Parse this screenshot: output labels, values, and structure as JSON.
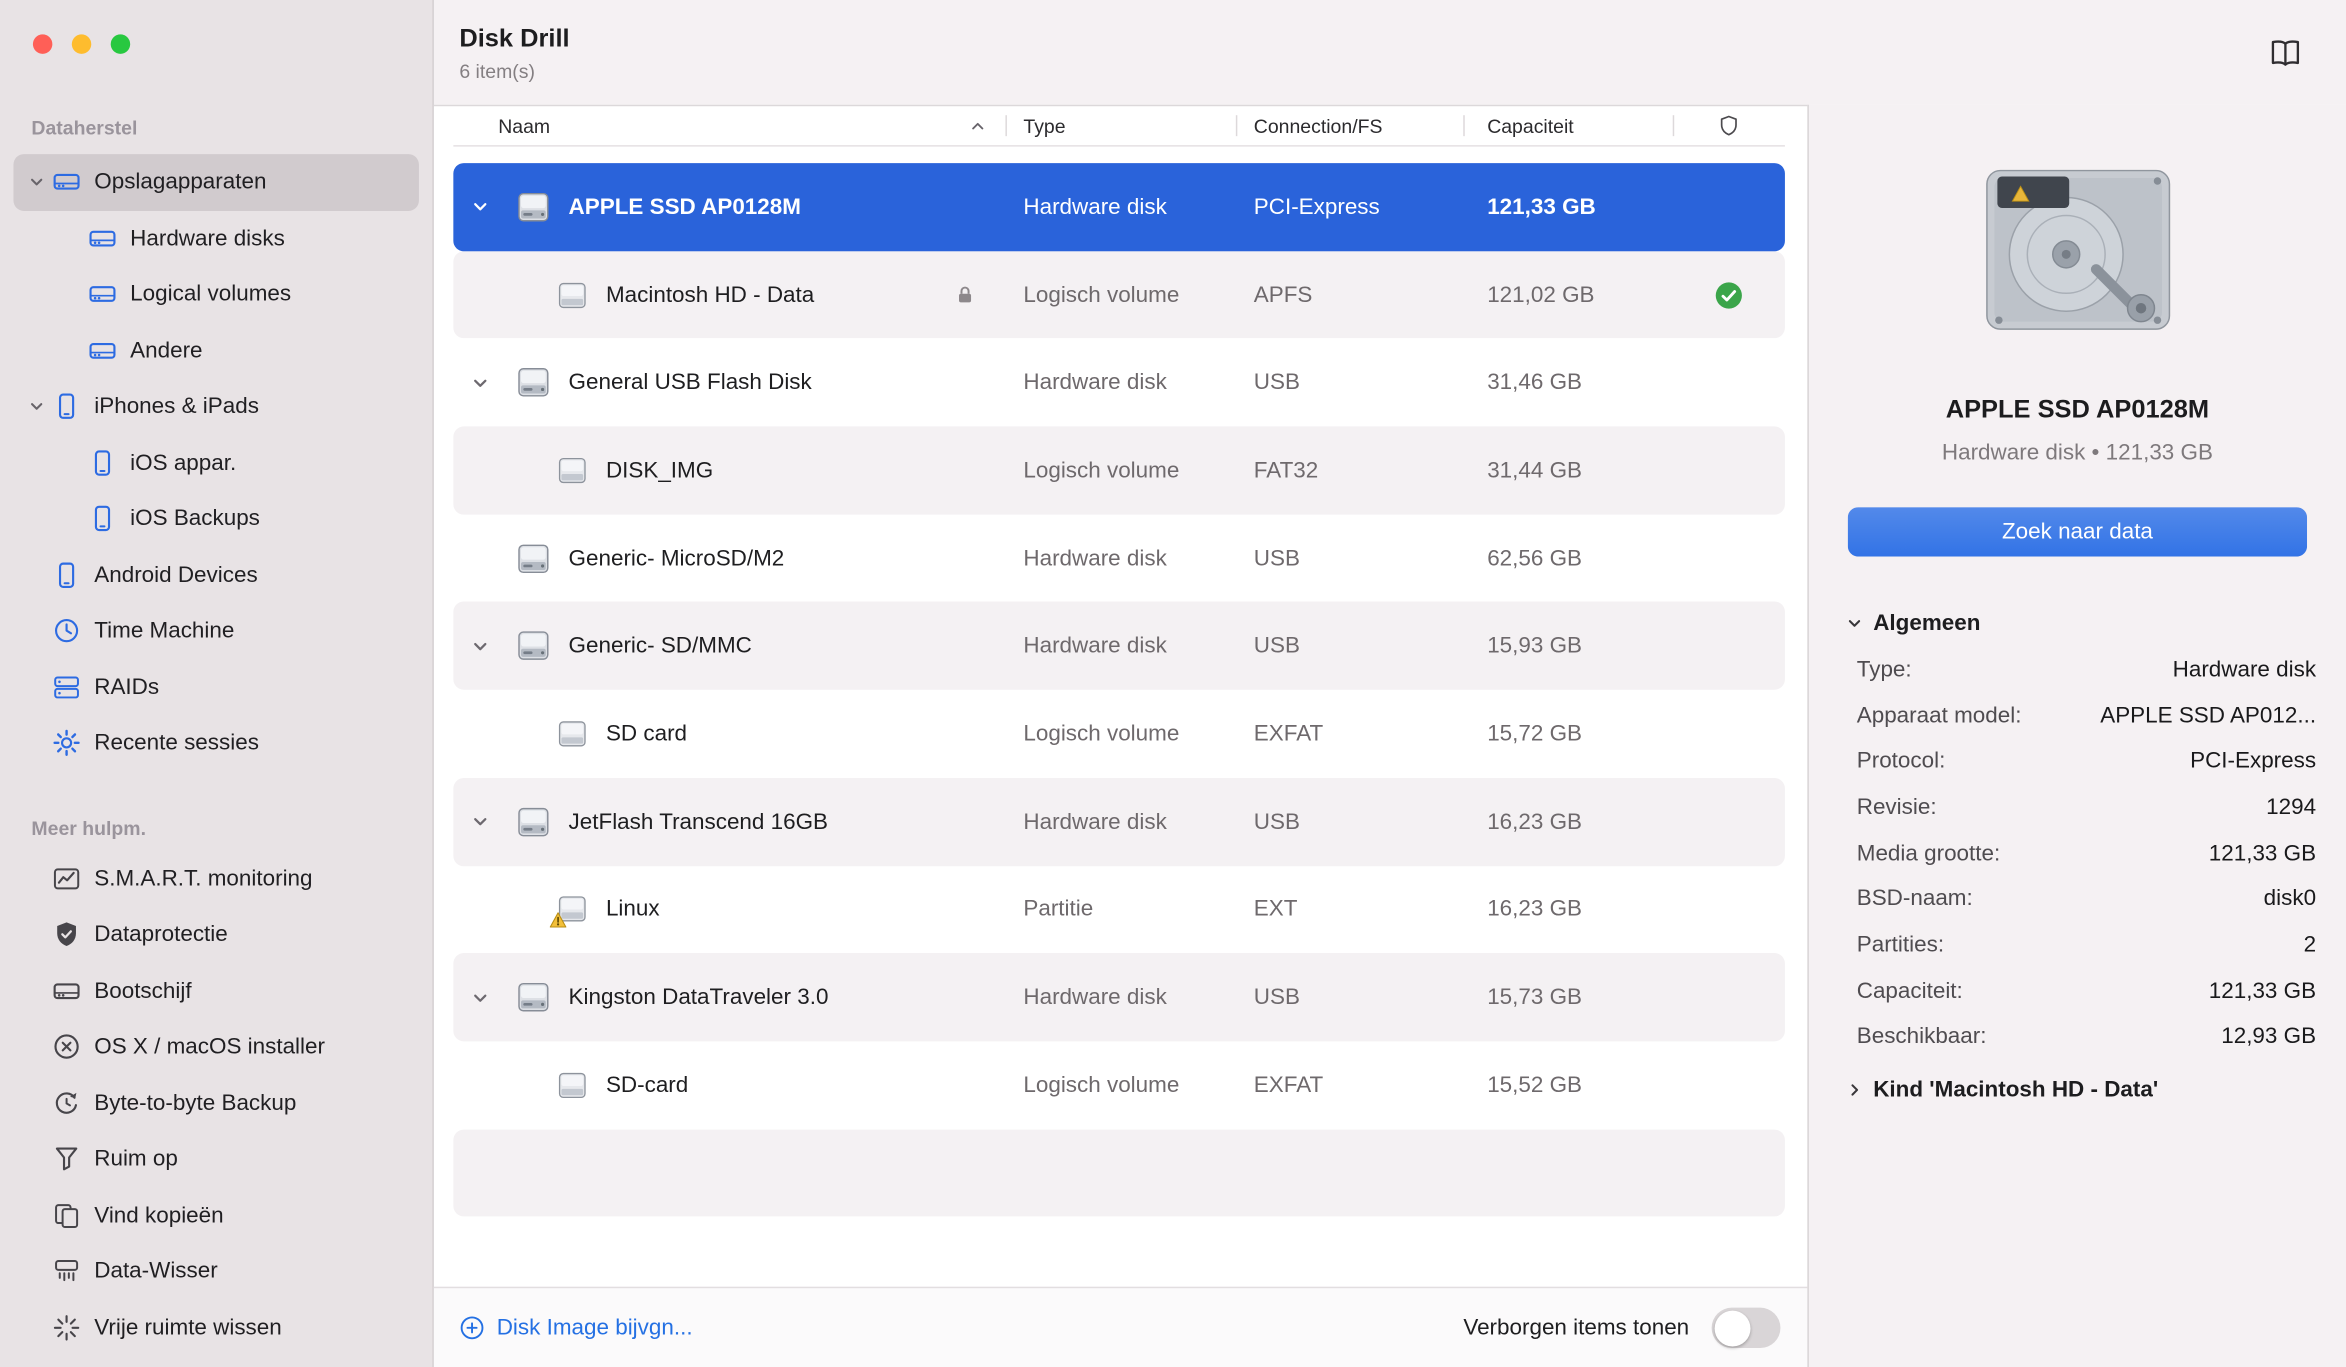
{
  "colors": {
    "accent_blue": "#2d6be2",
    "selection_blue": "#2a63da",
    "link_blue": "#2470e3",
    "status_green": "#3ba54a",
    "button_blue": "#3273e6"
  },
  "window": {
    "title": "Disk Drill",
    "item_count": "6 item(s)"
  },
  "sidebar": {
    "sections": [
      {
        "label": "Dataherstel",
        "items": [
          {
            "label": "Opslagapparaten",
            "icon": "drive-icon",
            "expandable": true,
            "expanded": true,
            "selected": true,
            "indent": 0
          },
          {
            "label": "Hardware disks",
            "icon": "drive-icon",
            "indent": 1
          },
          {
            "label": "Logical volumes",
            "icon": "drive-icon",
            "indent": 1
          },
          {
            "label": "Andere",
            "icon": "drive-icon",
            "indent": 1
          },
          {
            "label": "iPhones & iPads",
            "icon": "phone-icon",
            "expandable": true,
            "expanded": true,
            "indent": 0
          },
          {
            "label": "iOS appar.",
            "icon": "phone-icon",
            "indent": 1
          },
          {
            "label": "iOS Backups",
            "icon": "phone-icon",
            "indent": 1
          },
          {
            "label": "Android Devices",
            "icon": "phone-icon",
            "indent": 0
          },
          {
            "label": "Time Machine",
            "icon": "time-machine-icon",
            "indent": 0
          },
          {
            "label": "RAIDs",
            "icon": "raid-icon",
            "indent": 0
          },
          {
            "label": "Recente sessies",
            "icon": "gear-icon",
            "indent": 0
          }
        ]
      },
      {
        "label": "Meer hulpm.",
        "items": [
          {
            "label": "S.M.A.R.T. monitoring",
            "icon": "chart-icon",
            "indent": 0
          },
          {
            "label": "Dataprotectie",
            "icon": "shield-icon",
            "indent": 0
          },
          {
            "label": "Bootschijf",
            "icon": "drive-icon",
            "indent": 0
          },
          {
            "label": "OS X / macOS installer",
            "icon": "installer-icon",
            "indent": 0
          },
          {
            "label": "Byte-to-byte Backup",
            "icon": "backup-icon",
            "indent": 0
          },
          {
            "label": "Ruim op",
            "icon": "cleanup-icon",
            "indent": 0
          },
          {
            "label": "Vind kopieën",
            "icon": "copies-icon",
            "indent": 0
          },
          {
            "label": "Data-Wisser",
            "icon": "shredder-icon",
            "indent": 0
          },
          {
            "label": "Vrije ruimte wissen",
            "icon": "sparkle-icon",
            "indent": 0
          }
        ]
      }
    ]
  },
  "table": {
    "header": {
      "name": "Naam",
      "type": "Type",
      "fs": "Connection/FS",
      "capacity": "Capaciteit"
    },
    "sort": {
      "column": "Naam",
      "direction": "ascending"
    },
    "rows": [
      {
        "name": "APPLE SSD AP0128M",
        "type": "Hardware disk",
        "fs": "PCI-Express",
        "capacity": "121,33 GB",
        "level": 0,
        "expandable": true,
        "selected": true,
        "icon": "hard-drive-icon"
      },
      {
        "name": "Macintosh HD - Data",
        "type": "Logisch volume",
        "fs": "APFS",
        "capacity": "121,02 GB",
        "level": 1,
        "locked": true,
        "status": "ok",
        "icon": "volume-icon"
      },
      {
        "name": "General USB Flash Disk",
        "type": "Hardware disk",
        "fs": "USB",
        "capacity": "31,46 GB",
        "level": 0,
        "expandable": true,
        "icon": "hard-drive-icon"
      },
      {
        "name": "DISK_IMG",
        "type": "Logisch volume",
        "fs": "FAT32",
        "capacity": "31,44 GB",
        "level": 1,
        "icon": "volume-icon"
      },
      {
        "name": "Generic- MicroSD/M2",
        "type": "Hardware disk",
        "fs": "USB",
        "capacity": "62,56 GB",
        "level": 0,
        "icon": "hard-drive-icon"
      },
      {
        "name": "Generic- SD/MMC",
        "type": "Hardware disk",
        "fs": "USB",
        "capacity": "15,93 GB",
        "level": 0,
        "expandable": true,
        "icon": "hard-drive-icon"
      },
      {
        "name": "SD card",
        "type": "Logisch volume",
        "fs": "EXFAT",
        "capacity": "15,72 GB",
        "level": 1,
        "icon": "volume-icon"
      },
      {
        "name": "JetFlash Transcend 16GB",
        "type": "Hardware disk",
        "fs": "USB",
        "capacity": "16,23 GB",
        "level": 0,
        "expandable": true,
        "icon": "hard-drive-icon"
      },
      {
        "name": "Linux",
        "type": "Partitie",
        "fs": "EXT",
        "capacity": "16,23 GB",
        "level": 1,
        "warning": true,
        "icon": "volume-icon"
      },
      {
        "name": "Kingston DataTraveler 3.0",
        "type": "Hardware disk",
        "fs": "USB",
        "capacity": "15,73 GB",
        "level": 0,
        "expandable": true,
        "icon": "hard-drive-icon"
      },
      {
        "name": "SD-card",
        "type": "Logisch volume",
        "fs": "EXFAT",
        "capacity": "15,52 GB",
        "level": 1,
        "icon": "volume-icon"
      }
    ]
  },
  "footer": {
    "add_image_label": "Disk Image bijvgn...",
    "hidden_items_label": "Verborgen items tonen",
    "hidden_items_on": false
  },
  "detail": {
    "title": "APPLE SSD AP0128M",
    "subtitle": "Hardware disk • 121,33 GB",
    "action_button": "Zoek naar data",
    "sections": [
      {
        "label": "Algemeen",
        "expanded": true,
        "rows": [
          {
            "key": "Type:",
            "value": "Hardware disk"
          },
          {
            "key": "Apparaat model:",
            "value": "APPLE SSD AP012..."
          },
          {
            "key": "Protocol:",
            "value": "PCI-Express"
          },
          {
            "key": "Revisie:",
            "value": "1294"
          },
          {
            "key": "Media grootte:",
            "value": "121,33 GB"
          },
          {
            "key": "BSD-naam:",
            "value": "disk0"
          },
          {
            "key": "Partities:",
            "value": "2"
          },
          {
            "key": "Capaciteit:",
            "value": "121,33 GB"
          },
          {
            "key": "Beschikbaar:",
            "value": "12,93 GB"
          }
        ]
      },
      {
        "label": "Kind 'Macintosh HD - Data'",
        "expanded": false
      }
    ]
  }
}
